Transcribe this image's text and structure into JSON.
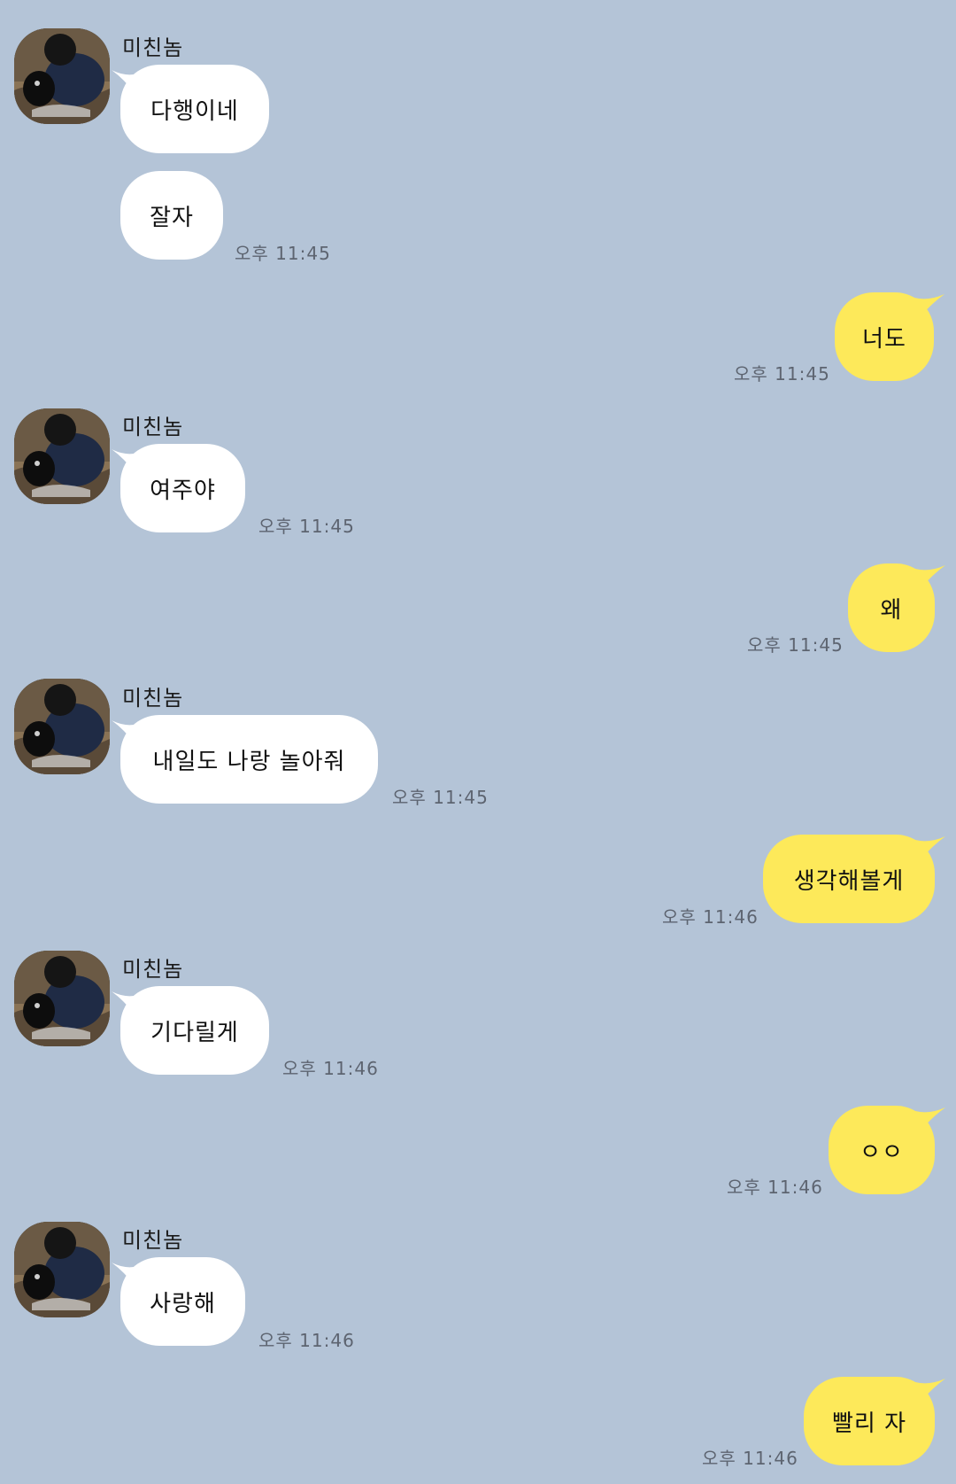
{
  "contact": {
    "name": "미친놈"
  },
  "colors": {
    "background": "#b4c4d7",
    "incoming_bubble": "#ffffff",
    "outgoing_bubble": "#fde95a"
  },
  "messages": [
    {
      "text": "다행이네",
      "time": ""
    },
    {
      "text": "잘자",
      "time": "오후 11:45"
    },
    {
      "text": "너도",
      "time": "오후 11:45"
    },
    {
      "text": "여주야",
      "time": "오후 11:45"
    },
    {
      "text": "왜",
      "time": "오후 11:45"
    },
    {
      "text": "내일도 나랑 놀아줘",
      "time": "오후 11:45"
    },
    {
      "text": "생각해볼게",
      "time": "오후 11:46"
    },
    {
      "text": "기다릴게",
      "time": "오후 11:46"
    },
    {
      "text": "ㅇㅇ",
      "time": "오후 11:46"
    },
    {
      "text": "사랑해",
      "time": "오후 11:46"
    },
    {
      "text": "빨리 자",
      "time": "오후 11:46"
    }
  ]
}
